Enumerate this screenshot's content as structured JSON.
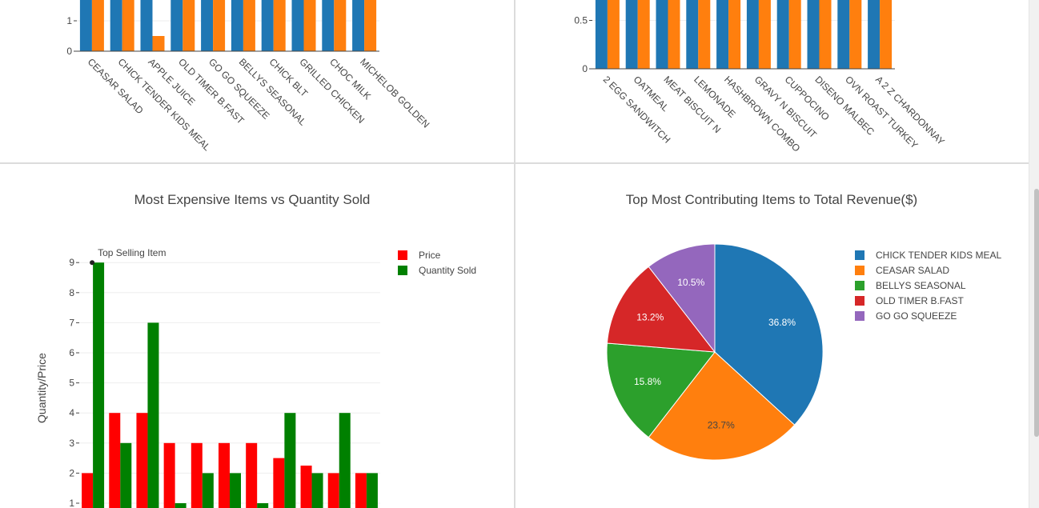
{
  "chart_data": [
    {
      "type": "bar",
      "categories": [
        "CEASAR SALAD",
        "CHICK TENDER KIDS MEAL",
        "APPLE JUICE",
        "OLD TIMER B.FAST",
        "GO GO SQUEEZE",
        "BELLYS SEASONAL",
        "CHICK BLT",
        "GRILLED CHICKEN",
        "CHOC MILK",
        "MICHELOB GOLDEN"
      ],
      "series": [
        {
          "values": [
            2,
            2,
            2,
            2,
            2,
            2,
            2,
            2,
            2,
            2
          ],
          "color": "#1f77b4"
        },
        {
          "values": [
            2,
            2,
            0.5,
            2,
            2,
            2,
            2,
            2,
            2,
            2
          ],
          "color": "#ff7f0e"
        }
      ],
      "yticks": [
        0,
        1
      ],
      "ylim": [
        0,
        1.65
      ],
      "grid": true
    },
    {
      "type": "bar",
      "categories": [
        "2 EGG SANDWITCH",
        "OATMEAL",
        "MEAT BISCUIT N",
        "LEMONADE",
        "HASHBROWN COMBO",
        "GRAVY N BISCUIT",
        "CUPPOCINO",
        "DISENO MALBEC",
        "OVN ROAST TURKEY",
        "A 2 Z CHARDONNAY"
      ],
      "series": [
        {
          "values": [
            1,
            1,
            1,
            1,
            1,
            1,
            1,
            1,
            1,
            1
          ],
          "color": "#1f77b4"
        },
        {
          "values": [
            1,
            1,
            1,
            1,
            1,
            1,
            1,
            1,
            1,
            1
          ],
          "color": "#ff7f0e"
        }
      ],
      "yticks": [
        0,
        0.5
      ],
      "ylim": [
        0,
        0.72
      ],
      "grid": true
    },
    {
      "type": "bar",
      "title": "Most Expensive Items vs Quantity Sold",
      "ylabel": "Quantity/Price",
      "annotation": "Top Selling Item",
      "legend_position": "top-right",
      "series": [
        {
          "name": "Price",
          "color": "#ff0000",
          "values": [
            2,
            4,
            4,
            3,
            3,
            3,
            3,
            2.5,
            2.25,
            2,
            2
          ]
        },
        {
          "name": "Quantity Sold",
          "color": "#008000",
          "values": [
            9,
            3,
            7,
            1,
            2,
            2,
            1,
            4,
            2,
            4,
            2
          ]
        }
      ],
      "yticks": [
        1,
        2,
        3,
        4,
        5,
        6,
        7,
        8,
        9
      ],
      "grid": true
    },
    {
      "type": "pie",
      "title": "Top Most Contributing Items to Total Revenue($)",
      "legend_position": "right",
      "slices": [
        {
          "label": "CHICK TENDER KIDS MEAL",
          "percent": 36.8,
          "text": "36.8%",
          "color": "#1f77b4"
        },
        {
          "label": "CEASAR SALAD",
          "percent": 23.7,
          "text": "23.7%",
          "color": "#ff7f0e"
        },
        {
          "label": "BELLYS SEASONAL",
          "percent": 15.8,
          "text": "15.8%",
          "color": "#2ca02c"
        },
        {
          "label": "OLD TIMER B.FAST",
          "percent": 13.2,
          "text": "13.2%",
          "color": "#d62728"
        },
        {
          "label": "GO GO SQUEEZE",
          "percent": 10.5,
          "text": "10.5%",
          "color": "#9467bd"
        }
      ]
    }
  ]
}
